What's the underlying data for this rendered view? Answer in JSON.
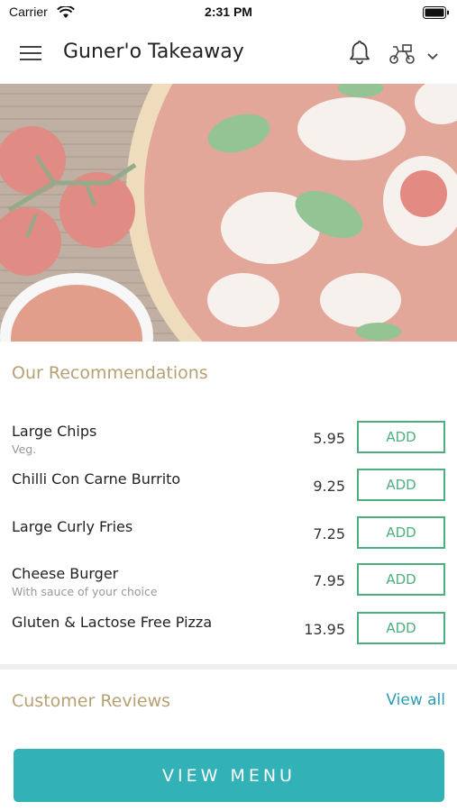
{
  "status_bar": {
    "carrier": "Carrier",
    "time": "2:31 PM",
    "icons": [
      "wifi-icon",
      "battery-icon"
    ]
  },
  "header": {
    "title": "Guner'o Takeaway",
    "icons": [
      "menu-icon",
      "bell-icon",
      "scooter-delivery-icon",
      "chevron-down-icon"
    ]
  },
  "hero": {
    "image": "pizza-and-tomatoes-photo"
  },
  "recommendations": {
    "title": "Our Recommendations",
    "items": [
      {
        "name": "Large Chips",
        "subtitle": "Veg.",
        "price": "5.95",
        "button": "ADD"
      },
      {
        "name": "Chilli Con Carne Burrito",
        "subtitle": "",
        "price": "9.25",
        "button": "ADD"
      },
      {
        "name": "Large Curly Fries",
        "subtitle": "",
        "price": "7.25",
        "button": "ADD"
      },
      {
        "name": "Cheese Burger",
        "subtitle": "With sauce of your choice",
        "price": "7.95",
        "button": "ADD"
      },
      {
        "name": "Gluten & Lactose Free Pizza",
        "subtitle": "",
        "price": "13.95",
        "button": "ADD"
      }
    ]
  },
  "reviews": {
    "title": "Customer Reviews",
    "view_all": "View all"
  },
  "footer": {
    "view_menu": "VIEW MENU"
  },
  "colors": {
    "accent_gold": "#b6a174",
    "add_green": "#4caf7f",
    "link_blue": "#2a9db3",
    "menu_button_teal": "#32b1b6"
  }
}
